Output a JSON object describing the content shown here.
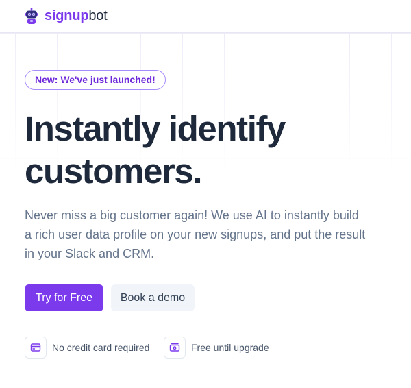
{
  "header": {
    "brand_bold": "signup",
    "brand_rest": "bot",
    "logo_icon": "robot-icon"
  },
  "hero": {
    "badge": "New: We've just launched!",
    "headline_line1": "Instantly identify",
    "headline_line2": "customers.",
    "description": "Never miss a big customer again! We use AI to instantly build a rich user data profile on your new signups, and put the result in your Slack and CRM."
  },
  "cta": {
    "primary_label": "Try for Free",
    "secondary_label": "Book a demo"
  },
  "features": [
    {
      "icon": "credit-card-icon",
      "label": "No credit card required"
    },
    {
      "icon": "cash-icon",
      "label": "Free until upgrade"
    }
  ],
  "colors": {
    "accent": "#7c3aed",
    "text_dark": "#1e293b",
    "text_muted": "#64748b",
    "secondary_button_bg": "#f1f5f9"
  }
}
